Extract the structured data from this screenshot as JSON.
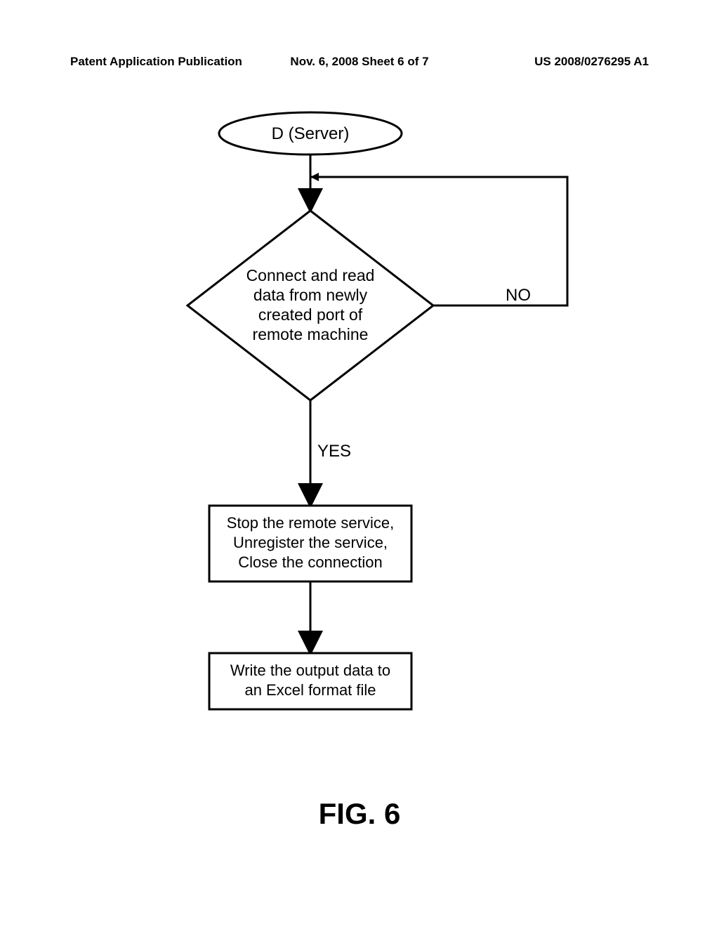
{
  "header": {
    "left": "Patent Application Publication",
    "mid": "Nov. 6, 2008  Sheet 6 of 7",
    "right": "US 2008/0276295 A1"
  },
  "flowchart": {
    "terminal": "D (Server)",
    "decision_line1": "Connect and read",
    "decision_line2": "data from newly",
    "decision_line3": "created port of",
    "decision_line4": "remote machine",
    "no_label": "NO",
    "yes_label": "YES",
    "process1_line1": "Stop the remote service,",
    "process1_line2": "Unregister the service,",
    "process1_line3": "Close the connection",
    "process2_line1": "Write the output data to",
    "process2_line2": "an Excel format file"
  },
  "figure": "FIG. 6"
}
